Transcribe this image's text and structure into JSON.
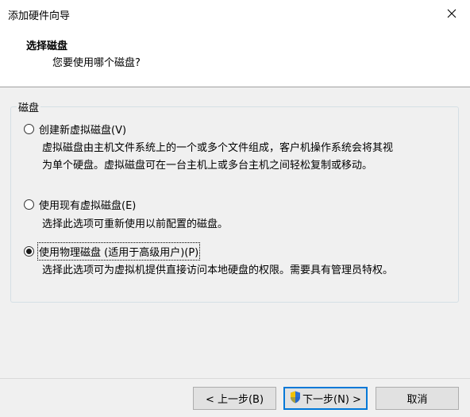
{
  "window": {
    "title": "添加硬件向导"
  },
  "header": {
    "title": "选择磁盘",
    "subtitle": "您要使用哪个磁盘?"
  },
  "group": {
    "label": "磁盘"
  },
  "options": [
    {
      "label": "创建新虚拟磁盘(V)",
      "desc_line1": "虚拟磁盘由主机文件系统上的一个或多个文件组成，客户机操作系统会将其视",
      "desc_line2": "为单个硬盘。虚拟磁盘可在一台主机上或多台主机之间轻松复制或移动。",
      "selected": false
    },
    {
      "label": "使用现有虚拟磁盘(E)",
      "desc_line1": "选择此选项可重新使用以前配置的磁盘。",
      "selected": false
    },
    {
      "label": "使用物理磁盘 (适用于高级用户)(P)",
      "desc_line1": "选择此选项可为虚拟机提供直接访问本地硬盘的权限。需要具有管理员特权。",
      "selected": true
    }
  ],
  "buttons": {
    "back": "< 上一步(B)",
    "next": "下一步(N) >",
    "cancel": "取消"
  },
  "colors": {
    "accent": "#0078d7"
  },
  "icons": {
    "close": "close-icon",
    "shield": "uac-shield-icon"
  }
}
